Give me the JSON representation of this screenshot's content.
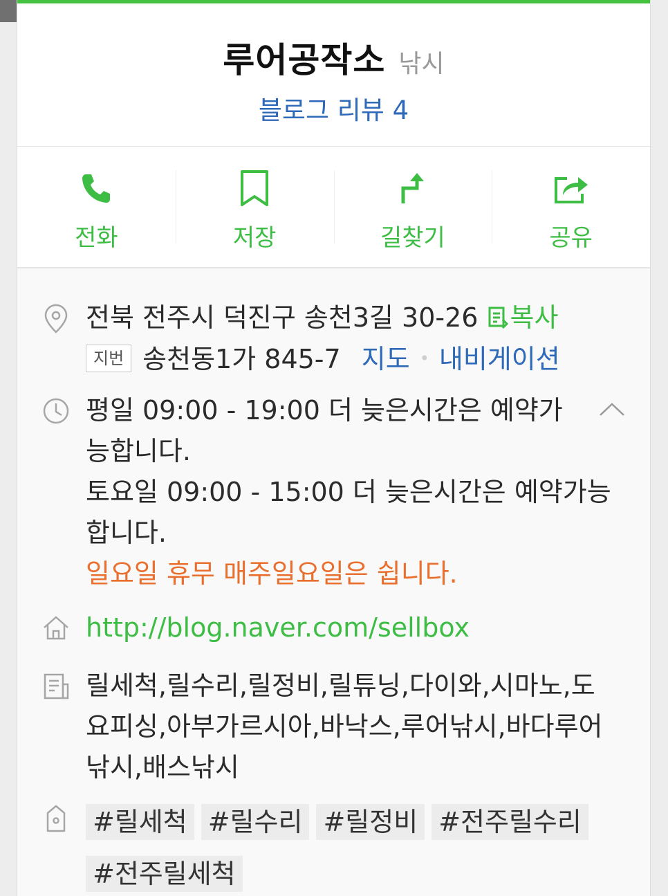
{
  "place": {
    "name": "루어공작소",
    "category": "낚시",
    "blog_review": "블로그 리뷰 4"
  },
  "actions": [
    {
      "label": "전화",
      "icon": "phone-icon"
    },
    {
      "label": "저장",
      "icon": "bookmark-icon"
    },
    {
      "label": "길찾기",
      "icon": "directions-icon"
    },
    {
      "label": "공유",
      "icon": "share-icon"
    }
  ],
  "address": {
    "road": "전북 전주시 덕진구 송천3길 30-26",
    "copy_label": "복사",
    "jibeon_badge": "지번",
    "jibeon": "송천동1가 845-7",
    "map_link": "지도",
    "separator": "•",
    "navigation_link": "내비게이션"
  },
  "hours": {
    "line1": "평일 09:00 - 19:00 더 늦은시간은 예약가",
    "line2": "능합니다.",
    "line3": "토요일 09:00 - 15:00 더 늦은시간은 예약가능",
    "line4": "합니다.",
    "closed": "일요일 휴무 매주일요일은 쉽니다."
  },
  "website": "http://blog.naver.com/sellbox",
  "description": {
    "line1": "릴세척,릴수리,릴정비,릴튜닝,다이와,시마노,도",
    "line2": "요피싱,아부가르시아,바낙스,루어낚시,바다루어",
    "line3": "낚시,배스낚시"
  },
  "tags": [
    "#릴세척",
    "#릴수리",
    "#릴정비",
    "#전주릴수리",
    "#전주릴세척"
  ],
  "colors": {
    "accent_green": "#3ebd45",
    "link_blue": "#2f6ab8",
    "closed_orange": "#e96f2f"
  }
}
